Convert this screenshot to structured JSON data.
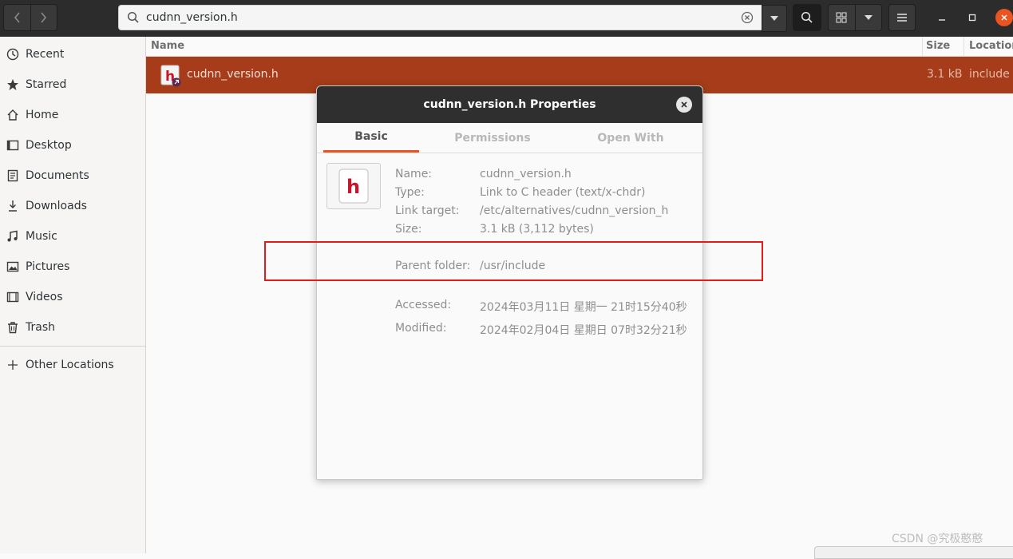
{
  "header": {
    "search_value": "cudnn_version.h",
    "back_icon": "chevron-left-icon",
    "forward_icon": "chevron-right-icon"
  },
  "sidebar": {
    "items": [
      {
        "label": "Recent",
        "icon": "clock-icon"
      },
      {
        "label": "Starred",
        "icon": "star-icon"
      },
      {
        "label": "Home",
        "icon": "home-icon"
      },
      {
        "label": "Desktop",
        "icon": "desktop-icon"
      },
      {
        "label": "Documents",
        "icon": "document-icon"
      },
      {
        "label": "Downloads",
        "icon": "download-icon"
      },
      {
        "label": "Music",
        "icon": "music-icon"
      },
      {
        "label": "Pictures",
        "icon": "picture-icon"
      },
      {
        "label": "Videos",
        "icon": "video-icon"
      },
      {
        "label": "Trash",
        "icon": "trash-icon"
      }
    ],
    "other_locations": "Other Locations"
  },
  "file_list": {
    "columns": {
      "name": "Name",
      "size": "Size",
      "location": "Location"
    },
    "rows": [
      {
        "name": "cudnn_version.h",
        "size": "3.1 kB",
        "location": "include"
      }
    ]
  },
  "dialog": {
    "title": "cudnn_version.h Properties",
    "tabs": [
      "Basic",
      "Permissions",
      "Open With"
    ],
    "icon_glyph": "h",
    "props": {
      "name_label": "Name:",
      "name_value": "cudnn_version.h",
      "type_label": "Type:",
      "type_value": "Link to C header (text/x-chdr)",
      "link_label": "Link target:",
      "link_value": "/etc/alternatives/cudnn_version_h",
      "size_label": "Size:",
      "size_value": "3.1 kB (3,112 bytes)",
      "parent_label": "Parent folder:",
      "parent_value": "/usr/include",
      "accessed_label": "Accessed:",
      "accessed_value": "2024年03月11日 星期一 21时15分40秒",
      "modified_label": "Modified:",
      "modified_value": "2024年02月04日 星期日 07时32分21秒"
    }
  },
  "watermark": "CSDN @究极憨憨",
  "colors": {
    "accent": "#e95420",
    "selection": "#a63c19",
    "highlight_box": "#e31b1b"
  }
}
